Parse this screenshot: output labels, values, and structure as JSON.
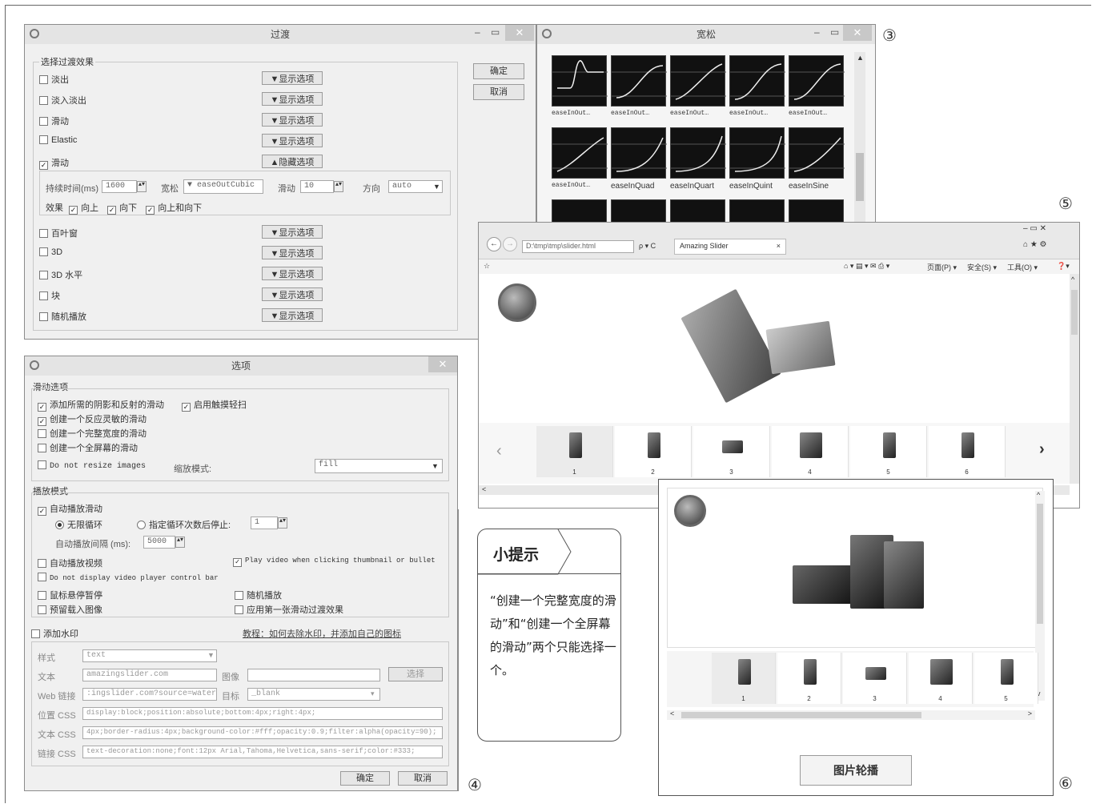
{
  "badges": {
    "b3": "③",
    "b4": "④",
    "b5": "⑤",
    "b6": "⑥"
  },
  "transition": {
    "title": "过渡",
    "group_title": "选择过渡效果",
    "ok": "确定",
    "cancel": "取消",
    "effects": [
      {
        "label": "淡出",
        "checked": false,
        "button": "▼显示选项"
      },
      {
        "label": "淡入淡出",
        "checked": false,
        "button": "▼显示选项"
      },
      {
        "label": "滑动",
        "checked": false,
        "button": "▼显示选项"
      },
      {
        "label": "Elastic",
        "checked": false,
        "button": "▼显示选项"
      },
      {
        "label": "滑动",
        "checked": true,
        "button": "▲隐藏选项"
      }
    ],
    "options": {
      "duration_label": "持续时间(ms)",
      "duration_value": "1600",
      "easing_label": "宽松",
      "easing_value": "▼ easeOutCubic",
      "slide_label": "滑动",
      "slide_value": "10",
      "direction_label": "方向",
      "direction_value": "auto",
      "effect_label": "效果",
      "effect_up": "向上",
      "effect_down": "向下",
      "effect_updown": "向上和向下"
    },
    "effects2": [
      {
        "label": "百叶窗",
        "checked": false,
        "button": "▼显示选项"
      },
      {
        "label": "3D",
        "checked": false,
        "button": "▼显示选项"
      },
      {
        "label": "3D 水平",
        "checked": false,
        "button": "▼显示选项"
      },
      {
        "label": "块",
        "checked": false,
        "button": "▼显示选项"
      },
      {
        "label": "随机播放",
        "checked": false,
        "button": "▼显示选项"
      }
    ]
  },
  "easing": {
    "title": "宽松",
    "row1": [
      "easeInOut…",
      "easeInOut…",
      "easeInOut…",
      "easeInOut…",
      "easeInOut…"
    ],
    "row2": [
      "easeInOut…",
      "easeInQuad",
      "easeInQuart",
      "easeInQuint",
      "easeInSine"
    ]
  },
  "options_win": {
    "title": "选项",
    "slide_group": "滑动选项",
    "slide_opts": [
      {
        "label": "添加所需的阴影和反射的滑动",
        "checked": true
      },
      {
        "label": "启用触摸轻扫",
        "checked": true
      },
      {
        "label": "创建一个反应灵敏的滑动",
        "checked": true
      },
      {
        "label": "创建一个完整宽度的滑动",
        "checked": false
      },
      {
        "label": "创建一个全屏幕的滑动",
        "checked": false
      },
      {
        "label": "Do not resize images",
        "checked": false
      }
    ],
    "scale_label": "缩放模式:",
    "scale_value": "fill",
    "play_group": "播放模式",
    "autoplay": "自动播放滑动",
    "loop_inf": "无限循环",
    "loop_stop": "指定循环次数后停止:",
    "loop_count": "1",
    "interval_label": "自动播放间隔 (ms):",
    "interval_value": "5000",
    "autoplay_video": "自动播放视频",
    "play_video_thumb": "Play video when clicking thumbnail or bullet",
    "no_video_bar": "Do not display video player control bar",
    "pause_hover": "鼠标悬停暂停",
    "random": "随机播放",
    "preload": "预留载入图像",
    "first_effect": "应用第一张滑动过渡效果",
    "watermark": "添加水印",
    "watermark_link": "教程：如何去除水印，并添加自己的图标",
    "style_label": "样式",
    "style_value": "text",
    "text_label": "文本",
    "text_value": "amazingslider.com",
    "image_label": "图像",
    "choose_btn": "选择",
    "weblink_label": "Web 链接",
    "weblink_value": ":ingslider.com?source=watermark",
    "target_label": "目标",
    "target_value": "_blank",
    "poscss_label": "位置 CSS",
    "poscss_value": "display:block;position:absolute;bottom:4px;right:4px;",
    "textcss_label": "文本 CSS",
    "textcss_value": "4px;border-radius:4px;background-color:#fff;opacity:0.9;filter:alpha(opacity=90);",
    "linkcss_label": "链接 CSS",
    "linkcss_value": "text-decoration:none;font:12px Arial,Tahoma,Helvetica,sans-serif;color:#333;",
    "ok": "确定",
    "cancel": "取消"
  },
  "browser": {
    "address": "D:\\tmp\\tmp\\slider.html",
    "search_hint": "ρ ▾ C",
    "tab_title": "Amazing Slider",
    "toolbar_items": [
      "页面(P) ▾",
      "安全(S) ▾",
      "工具(O) ▾"
    ],
    "thumbs": [
      "1",
      "2",
      "3",
      "4",
      "5",
      "6"
    ]
  },
  "slider2": {
    "thumbs": [
      "1",
      "2",
      "3",
      "4",
      "5"
    ],
    "caption_button": "图片轮播"
  },
  "tip": {
    "title": "小提示",
    "body": "“创建一个完整宽度的滑动”和“创建一个全屏幕的滑动”两个只能选择一个。"
  }
}
